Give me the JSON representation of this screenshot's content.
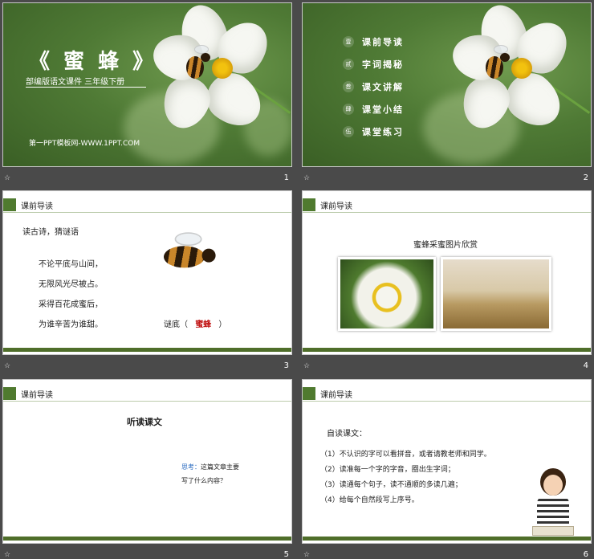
{
  "slides": [
    {
      "number": "1",
      "title": "《 蜜 蜂 》",
      "subtitle": "部编版语文课件  三年级下册",
      "site": "第一PPT模板网-WWW.1PPT.COM"
    },
    {
      "number": "2",
      "toc": [
        {
          "bullet": "壹",
          "label": "课前导读"
        },
        {
          "bullet": "贰",
          "label": "字词揭秘"
        },
        {
          "bullet": "叁",
          "label": "课文讲解"
        },
        {
          "bullet": "肆",
          "label": "课堂小结"
        },
        {
          "bullet": "伍",
          "label": "课堂练习"
        }
      ]
    },
    {
      "number": "3",
      "header": "课前导读",
      "intro": "读古诗，猜谜语",
      "poem": [
        "不论平底与山间，",
        "无限风光尽被占。",
        "采得百花成蜜后，",
        "为谁辛苦为谁甜。"
      ],
      "riddle_prefix": "谜底（",
      "riddle_answer": "蜜蜂",
      "riddle_suffix": "）"
    },
    {
      "number": "4",
      "header": "课前导读",
      "caption": "蜜蜂采蜜图片欣赏"
    },
    {
      "number": "5",
      "header": "课前导读",
      "heading": "听读课文",
      "think_label": "思考：",
      "think_line1": "这篇文章主要",
      "think_line2": "写了什么内容？"
    },
    {
      "number": "6",
      "header": "课前导读",
      "title": "自读课文：",
      "items": [
        "（1）不认识的字可以看拼音，或者请教老师和同学。",
        "（2）读准每一个字的字音，圈出生字词；",
        "（3）读通每个句子，读不通顺的多读几遍；",
        "（4）给每个自然段写上序号。"
      ]
    }
  ],
  "footer_anim_glyph": "☆",
  "colors": {
    "accent_green": "#4f7a2f",
    "answer_red": "#c01010",
    "think_blue": "#2a6bc0",
    "selection": "#d68f3a"
  }
}
